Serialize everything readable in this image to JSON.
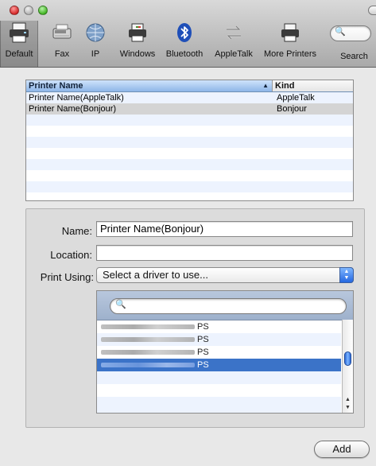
{
  "window": {
    "traffic_lights": [
      "close",
      "minimize",
      "zoom"
    ]
  },
  "toolbar": {
    "items": [
      {
        "label": "Default",
        "icon": "printer-icon",
        "selected": true
      },
      {
        "label": "Fax",
        "icon": "fax-icon",
        "selected": false
      },
      {
        "label": "IP",
        "icon": "globe-icon",
        "selected": false
      },
      {
        "label": "Windows",
        "icon": "windows-printer-icon",
        "selected": false
      },
      {
        "label": "Bluetooth",
        "icon": "bluetooth-icon",
        "selected": false
      },
      {
        "label": "AppleTalk",
        "icon": "appletalk-arrows-icon",
        "selected": false
      },
      {
        "label": "More Printers",
        "icon": "printer-icon",
        "selected": false
      }
    ],
    "search_label": "Search",
    "search_glyph": "🔍"
  },
  "printer_list": {
    "columns": {
      "name": "Printer Name",
      "kind": "Kind",
      "sort_indicator": "▲"
    },
    "rows": [
      {
        "name": "Printer Name(AppleTalk)",
        "kind": "AppleTalk",
        "selected": false
      },
      {
        "name": "Printer Name(Bonjour)",
        "kind": "Bonjour",
        "selected": true
      }
    ]
  },
  "form": {
    "name_label": "Name:",
    "name_value": "Printer Name(Bonjour)",
    "location_label": "Location:",
    "location_value": "",
    "print_using_label": "Print Using:",
    "print_using_value": "Select a driver to use..."
  },
  "drivers": {
    "search_glyph": "🔍",
    "rows": [
      {
        "suffix": "PS",
        "selected": false
      },
      {
        "suffix": "PS",
        "selected": false
      },
      {
        "suffix": "PS",
        "selected": false
      },
      {
        "suffix": "PS",
        "selected": true
      }
    ]
  },
  "add_button": "Add"
}
